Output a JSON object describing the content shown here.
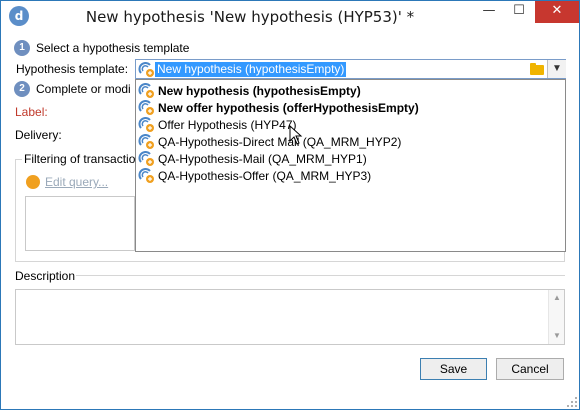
{
  "window": {
    "title": "New hypothesis 'New hypothesis (HYP53)' *",
    "app_icon": "d",
    "minimize": "—",
    "maximize": "☐",
    "close": "✕"
  },
  "step1": {
    "number": "1",
    "label": "Select a hypothesis template"
  },
  "template": {
    "label": "Hypothesis template:",
    "value": "New hypothesis (hypothesisEmpty)",
    "icon": "hypothesis-icon",
    "folder_icon": "folder-icon",
    "dropdown_icon": "chevron-down-icon"
  },
  "dropdown": {
    "options": [
      {
        "label": "New hypothesis (hypothesisEmpty)",
        "bold": true
      },
      {
        "label": "New offer hypothesis (offerHypothesisEmpty)",
        "bold": true
      },
      {
        "label": "Offer Hypothesis (HYP47)",
        "bold": false
      },
      {
        "label": "QA-Hypothesis-Direct Mail (QA_MRM_HYP2)",
        "bold": false
      },
      {
        "label": "QA-Hypothesis-Mail (QA_MRM_HYP1)",
        "bold": false
      },
      {
        "label": "QA-Hypothesis-Offer (QA_MRM_HYP3)",
        "bold": false
      }
    ]
  },
  "step2": {
    "number": "2",
    "label": "Complete or modi"
  },
  "fields": {
    "label_label": "Label:",
    "delivery_label": "Delivery:"
  },
  "filtering": {
    "legend": "Filtering of transactio",
    "edit_query": "Edit query..."
  },
  "description": {
    "legend": "Description"
  },
  "buttons": {
    "save": "Save",
    "cancel": "Cancel"
  },
  "colors": {
    "accent": "#3399ff",
    "label_red": "#c0392b",
    "close_red": "#c7372f",
    "link_gray": "#9aa9b9"
  }
}
